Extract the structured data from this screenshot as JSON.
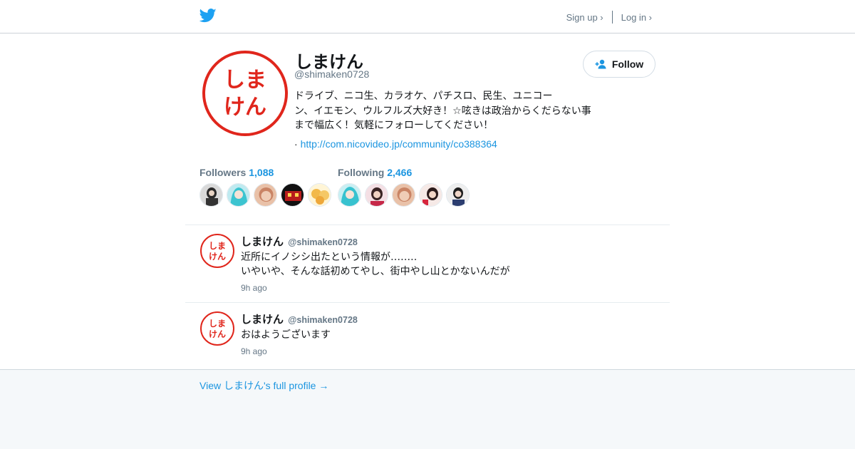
{
  "topbar": {
    "logo_icon": "twitter-bird-icon",
    "signup": "Sign up ›",
    "login": "Log in ›"
  },
  "profile": {
    "avatar_text": "しまけん",
    "name": "しまけん",
    "handle": "@shimaken0728",
    "bio_lines": [
      "ドライブ、ニコ生、カラオケ、パチスロ、民生、ユニコー",
      "ン、イエモン、ウルフルズ大好き！☆呟きは政治からくだらない事",
      "まで幅広く！気軽にフォローしてください！"
    ],
    "url_prefix": "· ",
    "url": "http://com.nicovideo.jp/community/co388364",
    "follow_label": "Follow"
  },
  "stats": {
    "followers_label": "Followers",
    "followers_count": "1,088",
    "following_label": "Following",
    "following_count": "2,466"
  },
  "tweets": [
    {
      "name": "しまけん",
      "handle": "@shimaken0728",
      "lines": [
        "近所にイノシシ出たという情報が‥‥‥‥",
        "いやいや、そんな話初めてやし、街中やし山とかないんだが"
      ],
      "time": "9h ago"
    },
    {
      "name": "しまけん",
      "handle": "@shimaken0728",
      "lines": [
        "おはようございます"
      ],
      "time": "9h ago"
    }
  ],
  "footer": {
    "link": "View しまけん's full profile →"
  },
  "colors": {
    "accent": "#1b95e0",
    "brand": "#1da1f2",
    "stamp_red": "#e0261c",
    "muted": "#657786"
  }
}
